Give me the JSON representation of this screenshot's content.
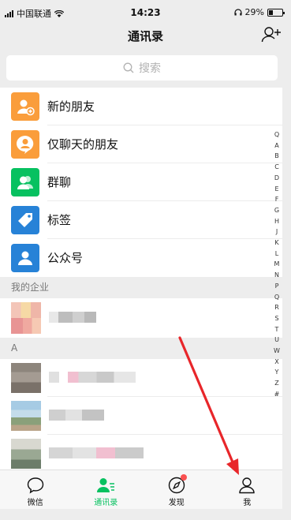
{
  "status_bar": {
    "carrier": "中国联通",
    "time": "14:23",
    "battery_percent": "29%",
    "battery_level": 0.29
  },
  "nav": {
    "title": "通讯录",
    "add_icon": "add-friend-icon"
  },
  "search": {
    "placeholder": "搜索",
    "icon": "search-icon"
  },
  "menu": [
    {
      "label": "新的朋友",
      "icon": "new-friend-icon",
      "color": "#fa9d3b"
    },
    {
      "label": "仅聊天的朋友",
      "icon": "chat-only-friend-icon",
      "color": "#fa9d3b"
    },
    {
      "label": "群聊",
      "icon": "group-chat-icon",
      "color": "#07c160"
    },
    {
      "label": "标签",
      "icon": "tag-icon",
      "color": "#2782d7"
    },
    {
      "label": "公众号",
      "icon": "official-account-icon",
      "color": "#2782d7"
    }
  ],
  "sections": {
    "enterprise": "我的企业",
    "a": "A"
  },
  "index_letters": [
    "Q",
    "A",
    "B",
    "C",
    "D",
    "E",
    "F",
    "G",
    "H",
    "J",
    "K",
    "L",
    "M",
    "N",
    "P",
    "Q",
    "R",
    "S",
    "T",
    "U",
    "W",
    "X",
    "Y",
    "Z",
    "#"
  ],
  "tabs": [
    {
      "label": "微信",
      "icon": "chat-icon",
      "active": false,
      "badge": false
    },
    {
      "label": "通讯录",
      "icon": "contacts-icon",
      "active": true,
      "badge": false
    },
    {
      "label": "发现",
      "icon": "compass-icon",
      "active": false,
      "badge": true
    },
    {
      "label": "我",
      "icon": "profile-icon",
      "active": false,
      "badge": false
    }
  ],
  "colors": {
    "accent": "#07c160",
    "orange": "#fa9d3b",
    "blue": "#2782d7",
    "annotation_arrow": "#e8262a",
    "badge": "#fa5151"
  }
}
